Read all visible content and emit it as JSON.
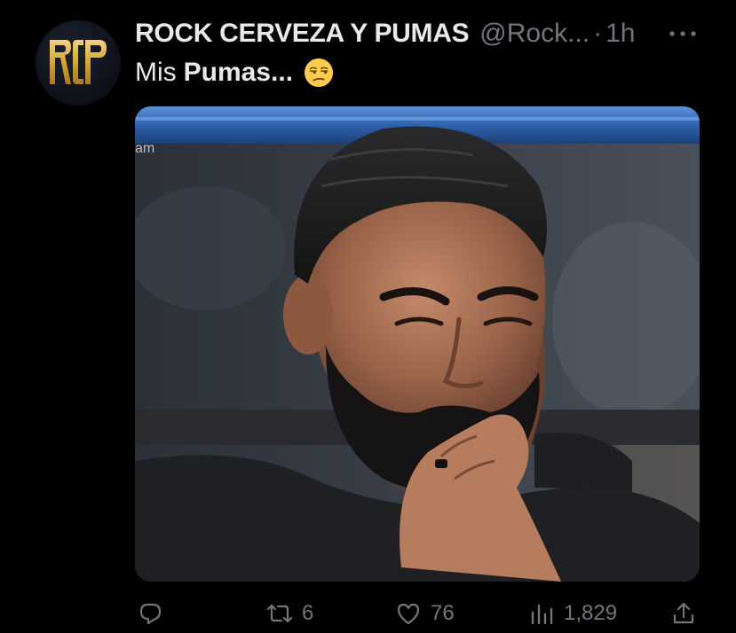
{
  "tweet": {
    "display_name": "ROCK CERVEZA Y PUMAS",
    "handle": "@Rock...",
    "separator": "·",
    "time": "1h",
    "text_prefix": "Mis",
    "text_bold": "Pumas...",
    "emoji": "unamused-face-emoji",
    "avatar_text": "RCP",
    "media": {
      "kind": "photo",
      "watermark": "am"
    },
    "stats": {
      "replies": "",
      "retweets": "6",
      "likes": "76",
      "views": "1,829"
    }
  },
  "icons": {
    "more": "more-horizontal-icon",
    "reply": "reply-icon",
    "retweet": "retweet-icon",
    "like": "heart-icon",
    "views": "views-chart-icon",
    "share": "share-icon"
  },
  "colors": {
    "background": "#000000",
    "primary_text": "#e7e9ea",
    "secondary_text": "#71767b",
    "avatar_gold": "#d4a63a"
  }
}
